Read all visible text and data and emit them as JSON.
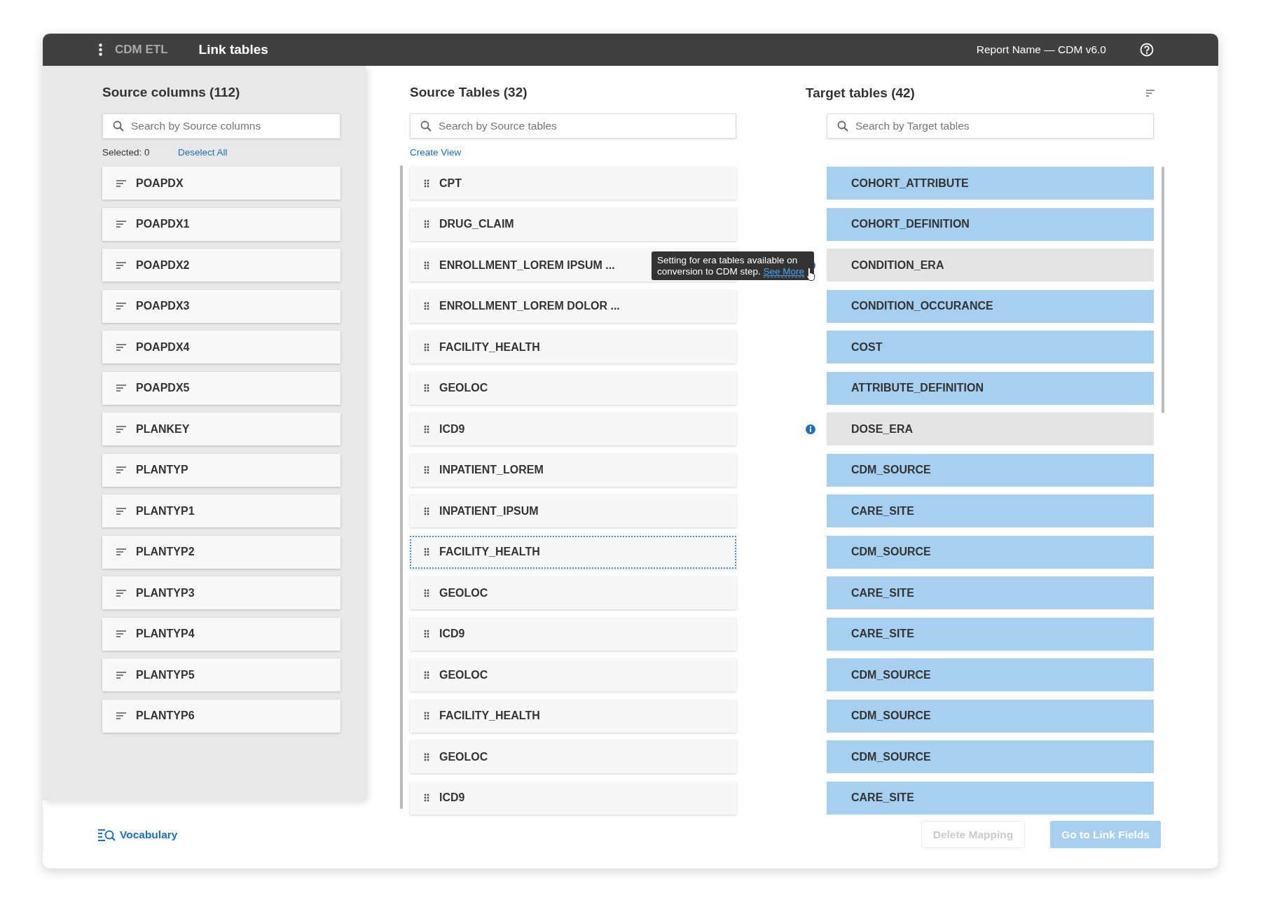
{
  "header": {
    "app": "CDM ETL",
    "title": "Link tables",
    "report": "Report Name — CDM v6.0"
  },
  "source_columns": {
    "title": "Source columns (112)",
    "search": {
      "placeholder": "Search by Source columns"
    },
    "selected_label": "Selected: 0",
    "deselect": "Deselect All",
    "items": [
      "POAPDX",
      "POAPDX1",
      "POAPDX2",
      "POAPDX3",
      "POAPDX4",
      "POAPDX5",
      "PLANKEY",
      "PLANTYP",
      "PLANTYP1",
      "PLANTYP2",
      "PLANTYP3",
      "PLANTYP4",
      "PLANTYP5",
      "PLANTYP6"
    ]
  },
  "source_tables": {
    "title": "Source Tables (32)",
    "search": {
      "placeholder": "Search by Source tables"
    },
    "create_view": "Create View",
    "items": [
      {
        "label": "CPT",
        "selected": false
      },
      {
        "label": "DRUG_CLAIM",
        "selected": false
      },
      {
        "label": "ENROLLMENT_LOREM IPSUM ...",
        "selected": false
      },
      {
        "label": "ENROLLMENT_LOREM DOLOR ...",
        "selected": false
      },
      {
        "label": "FACILITY_HEALTH",
        "selected": false
      },
      {
        "label": "GEOLOC",
        "selected": false
      },
      {
        "label": "ICD9",
        "selected": false
      },
      {
        "label": "INPATIENT_LOREM",
        "selected": false
      },
      {
        "label": "INPATIENT_IPSUM",
        "selected": false
      },
      {
        "label": "FACILITY_HEALTH",
        "selected": true
      },
      {
        "label": "GEOLOC",
        "selected": false
      },
      {
        "label": "ICD9",
        "selected": false
      },
      {
        "label": "GEOLOC",
        "selected": false
      },
      {
        "label": "FACILITY_HEALTH",
        "selected": false
      },
      {
        "label": "GEOLOC",
        "selected": false
      },
      {
        "label": "ICD9",
        "selected": false
      }
    ]
  },
  "target_tables": {
    "title": "Target tables (42)",
    "search": {
      "placeholder": "Search by Target tables"
    },
    "items": [
      {
        "label": "COHORT_ATTRIBUTE",
        "linked": true
      },
      {
        "label": "COHORT_DEFINITION",
        "linked": true
      },
      {
        "label": "CONDITION_ERA",
        "linked": false,
        "tooltip": {
          "text": "Setting for era tables available on conversion to CDM step.",
          "link": "See More"
        }
      },
      {
        "label": "CONDITION_OCCURANCE",
        "linked": true
      },
      {
        "label": "COST",
        "linked": true
      },
      {
        "label": "ATTRIBUTE_DEFINITION",
        "linked": true
      },
      {
        "label": "DOSE_ERA",
        "linked": false
      },
      {
        "label": "CDM_SOURCE",
        "linked": true
      },
      {
        "label": "CARE_SITE",
        "linked": true
      },
      {
        "label": "CDM_SOURCE",
        "linked": true
      },
      {
        "label": "CARE_SITE",
        "linked": true
      },
      {
        "label": "CARE_SITE",
        "linked": true
      },
      {
        "label": "CDM_SOURCE",
        "linked": true
      },
      {
        "label": "CDM_SOURCE",
        "linked": true
      },
      {
        "label": "CDM_SOURCE",
        "linked": true
      },
      {
        "label": "CARE_SITE",
        "linked": true
      }
    ]
  },
  "footer": {
    "vocabulary": "Vocabulary",
    "buttons": [
      {
        "label": "Delete Mapping",
        "kind": "secondary",
        "disabled": true
      },
      {
        "label": "Go to Link Fields",
        "kind": "primary",
        "disabled": true
      }
    ]
  }
}
